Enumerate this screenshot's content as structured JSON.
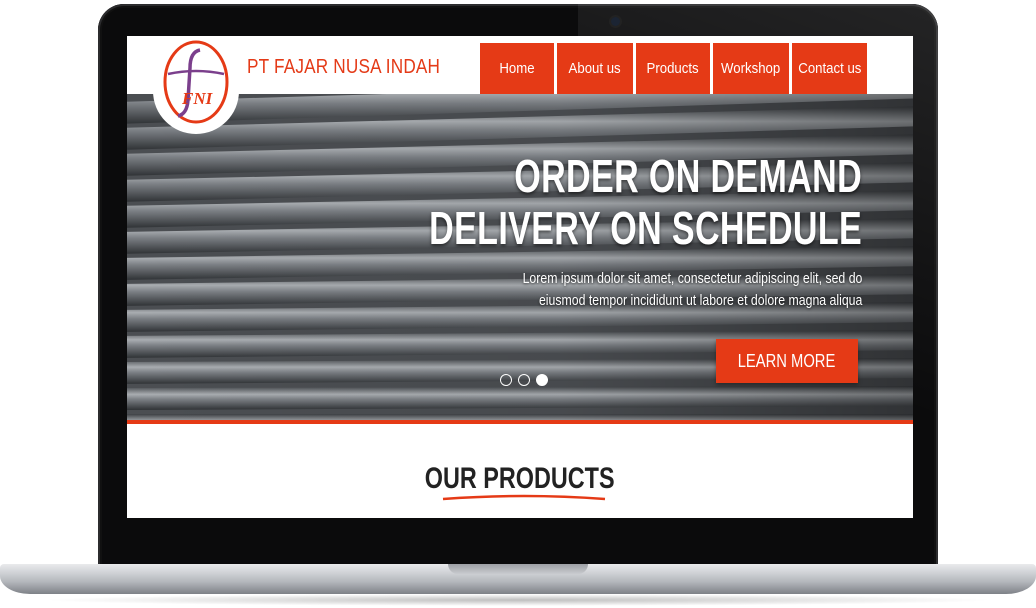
{
  "company": {
    "name": "PT FAJAR NUSA INDAH",
    "logo_text": "FNI"
  },
  "nav": {
    "items": [
      {
        "label": "Home",
        "width": 74
      },
      {
        "label": "About us",
        "width": 76
      },
      {
        "label": "Products",
        "width": 74
      },
      {
        "label": "Workshop",
        "width": 76
      },
      {
        "label": "Contact us",
        "width": 75
      }
    ]
  },
  "hero": {
    "title_line1": "ORDER ON DEMAND",
    "title_line2": "DELIVERY ON SCHEDULE",
    "subtitle_line1": "Lorem ipsum dolor sit amet, consectetur adipiscing elit, sed do",
    "subtitle_line2": "eiusmod tempor incididunt ut labore et dolore magna aliqua",
    "cta_label": "LEARN MORE",
    "slides": 3,
    "active_slide": 3
  },
  "products": {
    "title": "OUR PRODUCTS"
  },
  "colors": {
    "accent": "#e53a16",
    "text_dark": "#222222"
  },
  "icons": {
    "logo": "company-logo-icon"
  }
}
